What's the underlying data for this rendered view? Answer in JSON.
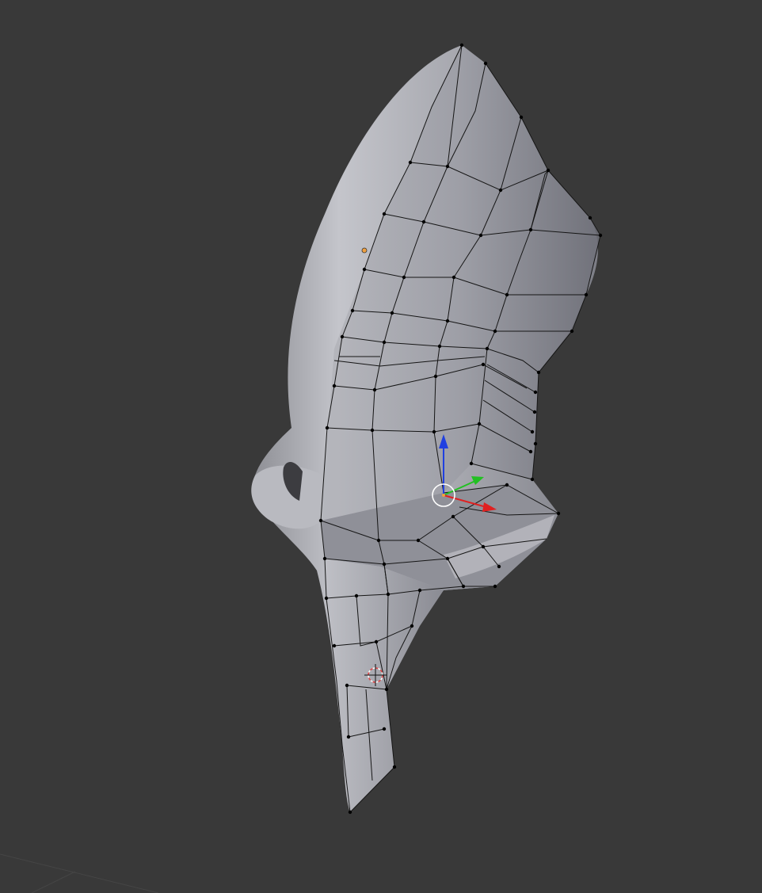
{
  "viewport": {
    "background": "#393939",
    "grid_color": "#444444",
    "mode": "edit-mode",
    "shading": "solid"
  },
  "mesh": {
    "surface_color": "#a9aab1",
    "edge_color": "#111111",
    "vertex_color": "#000000"
  },
  "gizmo": {
    "x_axis_color": "#e02020",
    "y_axis_color": "#22c022",
    "z_axis_color": "#2040e0",
    "pivot_ring_color": "#ffffff"
  },
  "cursor": {
    "color": "#e04040"
  },
  "object_origin": {
    "color": "#f0a040"
  }
}
